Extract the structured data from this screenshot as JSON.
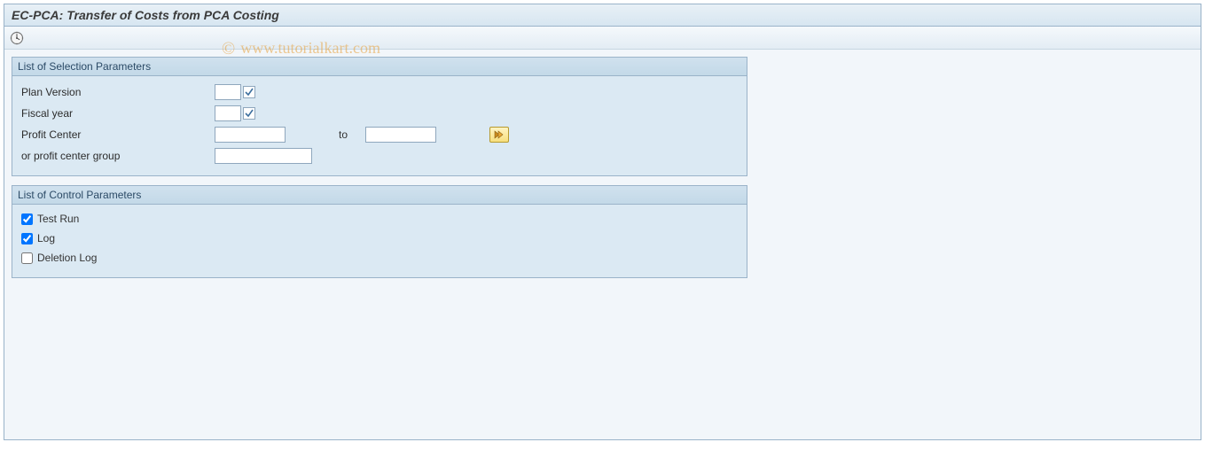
{
  "title": "EC-PCA: Transfer of Costs from PCA Costing",
  "watermark": "www.tutorialkart.com",
  "selection": {
    "title": "List of Selection Parameters",
    "plan_version_label": "Plan Version",
    "plan_version_value": "",
    "fiscal_year_label": "Fiscal year",
    "fiscal_year_value": "",
    "profit_center_label": "Profit Center",
    "profit_center_from": "",
    "to_label": "to",
    "profit_center_to": "",
    "group_label": "or profit center group",
    "group_value": ""
  },
  "control": {
    "title": "List of Control Parameters",
    "test_run_label": "Test Run",
    "test_run_checked": true,
    "log_label": "Log",
    "log_checked": true,
    "deletion_log_label": "Deletion Log",
    "deletion_log_checked": false
  }
}
